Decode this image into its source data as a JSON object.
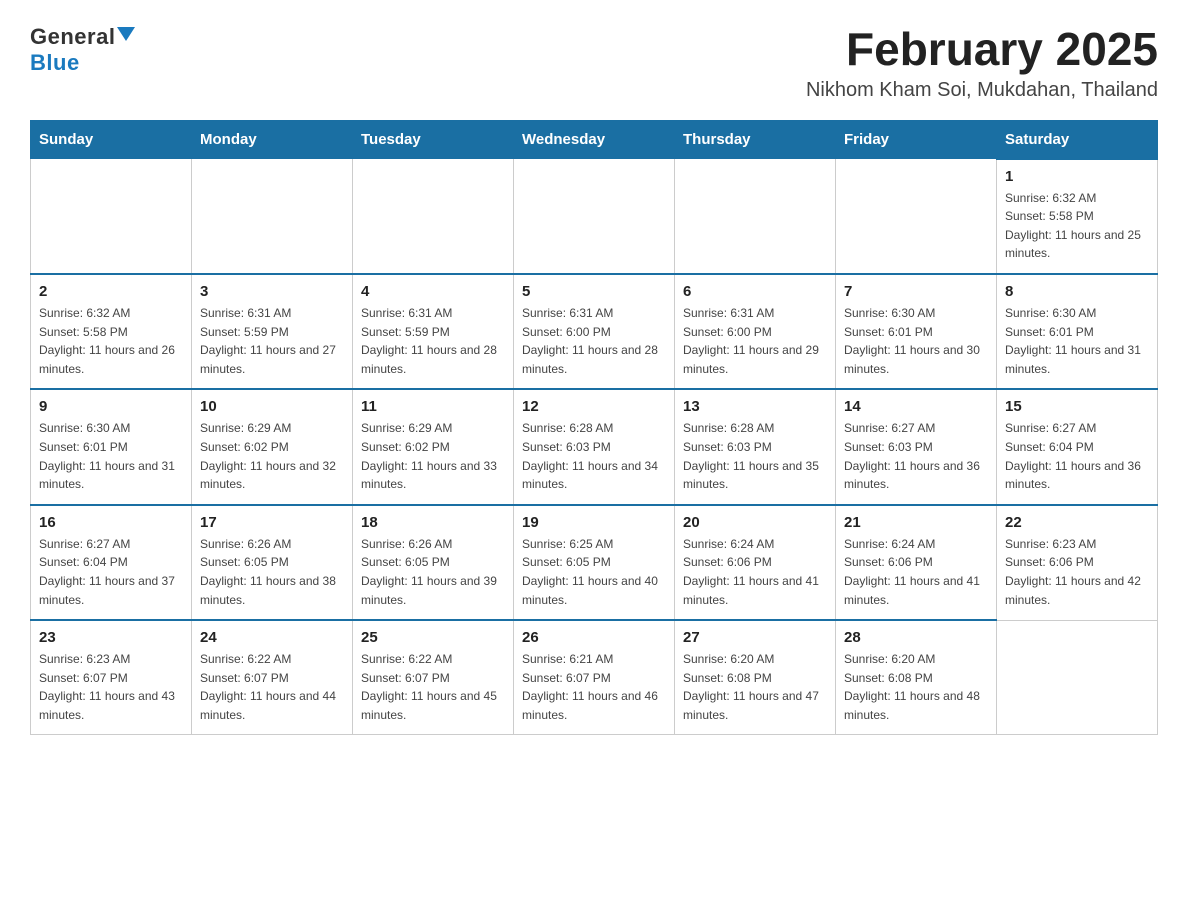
{
  "logo": {
    "general": "General",
    "blue": "Blue"
  },
  "header": {
    "title": "February 2025",
    "location": "Nikhom Kham Soi, Mukdahan, Thailand"
  },
  "days_of_week": [
    "Sunday",
    "Monday",
    "Tuesday",
    "Wednesday",
    "Thursday",
    "Friday",
    "Saturday"
  ],
  "weeks": [
    [
      {
        "day": "",
        "info": ""
      },
      {
        "day": "",
        "info": ""
      },
      {
        "day": "",
        "info": ""
      },
      {
        "day": "",
        "info": ""
      },
      {
        "day": "",
        "info": ""
      },
      {
        "day": "",
        "info": ""
      },
      {
        "day": "1",
        "info": "Sunrise: 6:32 AM\nSunset: 5:58 PM\nDaylight: 11 hours and 25 minutes."
      }
    ],
    [
      {
        "day": "2",
        "info": "Sunrise: 6:32 AM\nSunset: 5:58 PM\nDaylight: 11 hours and 26 minutes."
      },
      {
        "day": "3",
        "info": "Sunrise: 6:31 AM\nSunset: 5:59 PM\nDaylight: 11 hours and 27 minutes."
      },
      {
        "day": "4",
        "info": "Sunrise: 6:31 AM\nSunset: 5:59 PM\nDaylight: 11 hours and 28 minutes."
      },
      {
        "day": "5",
        "info": "Sunrise: 6:31 AM\nSunset: 6:00 PM\nDaylight: 11 hours and 28 minutes."
      },
      {
        "day": "6",
        "info": "Sunrise: 6:31 AM\nSunset: 6:00 PM\nDaylight: 11 hours and 29 minutes."
      },
      {
        "day": "7",
        "info": "Sunrise: 6:30 AM\nSunset: 6:01 PM\nDaylight: 11 hours and 30 minutes."
      },
      {
        "day": "8",
        "info": "Sunrise: 6:30 AM\nSunset: 6:01 PM\nDaylight: 11 hours and 31 minutes."
      }
    ],
    [
      {
        "day": "9",
        "info": "Sunrise: 6:30 AM\nSunset: 6:01 PM\nDaylight: 11 hours and 31 minutes."
      },
      {
        "day": "10",
        "info": "Sunrise: 6:29 AM\nSunset: 6:02 PM\nDaylight: 11 hours and 32 minutes."
      },
      {
        "day": "11",
        "info": "Sunrise: 6:29 AM\nSunset: 6:02 PM\nDaylight: 11 hours and 33 minutes."
      },
      {
        "day": "12",
        "info": "Sunrise: 6:28 AM\nSunset: 6:03 PM\nDaylight: 11 hours and 34 minutes."
      },
      {
        "day": "13",
        "info": "Sunrise: 6:28 AM\nSunset: 6:03 PM\nDaylight: 11 hours and 35 minutes."
      },
      {
        "day": "14",
        "info": "Sunrise: 6:27 AM\nSunset: 6:03 PM\nDaylight: 11 hours and 36 minutes."
      },
      {
        "day": "15",
        "info": "Sunrise: 6:27 AM\nSunset: 6:04 PM\nDaylight: 11 hours and 36 minutes."
      }
    ],
    [
      {
        "day": "16",
        "info": "Sunrise: 6:27 AM\nSunset: 6:04 PM\nDaylight: 11 hours and 37 minutes."
      },
      {
        "day": "17",
        "info": "Sunrise: 6:26 AM\nSunset: 6:05 PM\nDaylight: 11 hours and 38 minutes."
      },
      {
        "day": "18",
        "info": "Sunrise: 6:26 AM\nSunset: 6:05 PM\nDaylight: 11 hours and 39 minutes."
      },
      {
        "day": "19",
        "info": "Sunrise: 6:25 AM\nSunset: 6:05 PM\nDaylight: 11 hours and 40 minutes."
      },
      {
        "day": "20",
        "info": "Sunrise: 6:24 AM\nSunset: 6:06 PM\nDaylight: 11 hours and 41 minutes."
      },
      {
        "day": "21",
        "info": "Sunrise: 6:24 AM\nSunset: 6:06 PM\nDaylight: 11 hours and 41 minutes."
      },
      {
        "day": "22",
        "info": "Sunrise: 6:23 AM\nSunset: 6:06 PM\nDaylight: 11 hours and 42 minutes."
      }
    ],
    [
      {
        "day": "23",
        "info": "Sunrise: 6:23 AM\nSunset: 6:07 PM\nDaylight: 11 hours and 43 minutes."
      },
      {
        "day": "24",
        "info": "Sunrise: 6:22 AM\nSunset: 6:07 PM\nDaylight: 11 hours and 44 minutes."
      },
      {
        "day": "25",
        "info": "Sunrise: 6:22 AM\nSunset: 6:07 PM\nDaylight: 11 hours and 45 minutes."
      },
      {
        "day": "26",
        "info": "Sunrise: 6:21 AM\nSunset: 6:07 PM\nDaylight: 11 hours and 46 minutes."
      },
      {
        "day": "27",
        "info": "Sunrise: 6:20 AM\nSunset: 6:08 PM\nDaylight: 11 hours and 47 minutes."
      },
      {
        "day": "28",
        "info": "Sunrise: 6:20 AM\nSunset: 6:08 PM\nDaylight: 11 hours and 48 minutes."
      },
      {
        "day": "",
        "info": ""
      }
    ]
  ]
}
